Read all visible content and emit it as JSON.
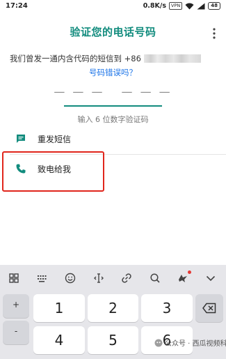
{
  "status_bar": {
    "time": "17:24",
    "net_speed": "0.8K/s",
    "vpn": "VPN",
    "battery": "48",
    "icons": [
      "wifi-icon",
      "signal-icon",
      "battery-icon"
    ]
  },
  "header": {
    "title": "验证您的电话号码",
    "menu_icon": "more-vert-icon"
  },
  "description": {
    "text": "我们曾发一通内含代码的短信到 +86"
  },
  "wrong_number_link": "号码错误吗？",
  "code_input": {
    "group1": "— — —",
    "group2": "— — —",
    "hint": "输入 6 位数字验证码"
  },
  "options": [
    {
      "label": "重发短信",
      "icon": "message-icon"
    },
    {
      "label": "致电给我",
      "icon": "phone-icon"
    }
  ],
  "keyboard": {
    "toolbar_icons": [
      "grid-icon",
      "keyboard-icon",
      "emoji-icon",
      "cursor-icon",
      "link-icon",
      "search-icon",
      "bird-icon",
      "chevron-down-icon"
    ],
    "side_keys": [
      "+",
      "-"
    ],
    "keys": [
      "1",
      "2",
      "3",
      "4",
      "5",
      "6"
    ],
    "backspace_icon": "backspace-icon"
  },
  "watermark": {
    "text": "公众号 · 西瓜视频科技"
  },
  "colors": {
    "accent": "#128c7e",
    "link": "#1a73e8",
    "highlight": "#e0251b",
    "keyboard_bg": "#e6e6ea"
  }
}
